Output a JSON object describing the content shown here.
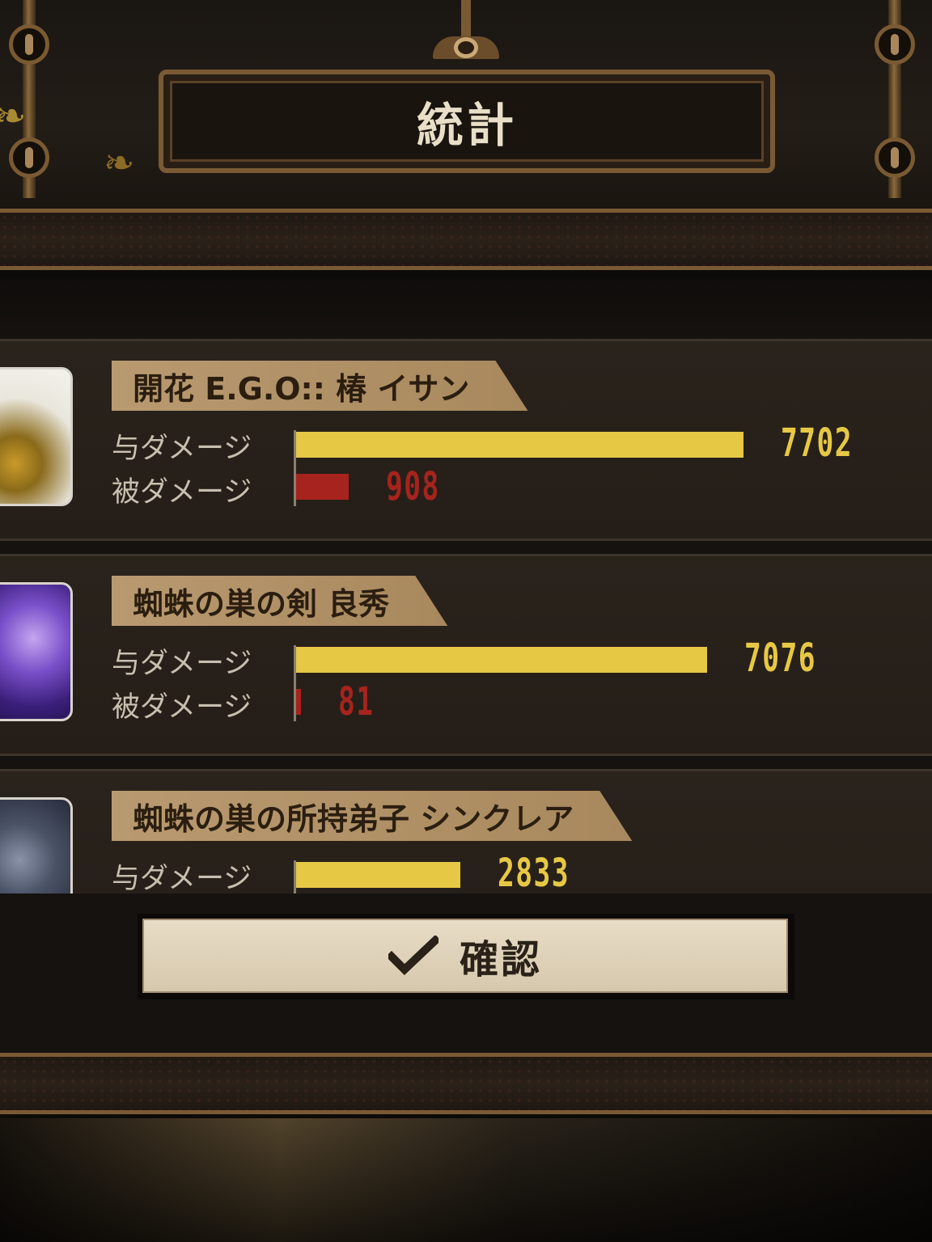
{
  "header": {
    "title": "統計"
  },
  "colors": {
    "dealt_bar": "#e7c844",
    "taken_bar": "#a7231d",
    "name_plate": "#b99a70",
    "frame": "#7a5a34"
  },
  "stats": {
    "max_value": 7702,
    "entries": [
      {
        "name": "開花 E.G.O:: 椿 イサン",
        "dealt_label": "与ダメージ",
        "dealt_value": "7702",
        "dealt": 7702,
        "taken_label": "被ダメージ",
        "taken_value": "908",
        "taken": 908
      },
      {
        "name": "蜘蛛の巣の剣 良秀",
        "dealt_label": "与ダメージ",
        "dealt_value": "7076",
        "dealt": 7076,
        "taken_label": "被ダメージ",
        "taken_value": "81",
        "taken": 81
      },
      {
        "name": "蜘蛛の巣の所持弟子 シンクレア",
        "dealt_label": "与ダメージ",
        "dealt_value": "2833",
        "dealt": 2833
      }
    ]
  },
  "confirm": {
    "label": "確認",
    "icon": "check-icon"
  }
}
